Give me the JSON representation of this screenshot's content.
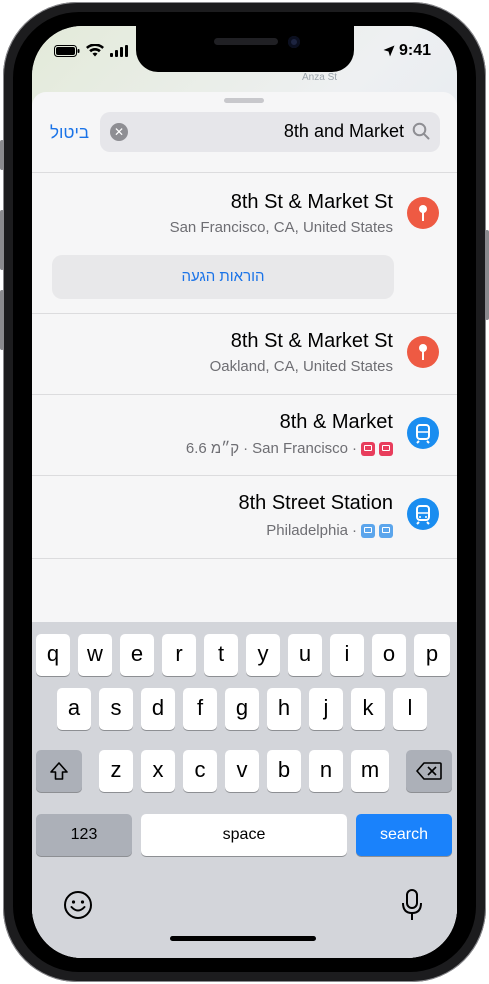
{
  "status_bar": {
    "time": "9:41"
  },
  "map": {
    "road_label": "Anza St"
  },
  "search": {
    "cancel_label": "ביטול",
    "query": "8th and Market"
  },
  "results": [
    {
      "title": "8th St & Market St",
      "subtitle": "San Francisco, CA, United States",
      "icon": "pin-icon",
      "directions_label": "הוראות הגעה"
    },
    {
      "title": "8th St & Market St",
      "subtitle": "Oakland, CA, United States",
      "icon": "pin-icon"
    },
    {
      "title": "8th & Market",
      "subtitle_distance": "6.6 ק״מ",
      "subtitle_city": "San Francisco",
      "icon": "tram-icon"
    },
    {
      "title": "8th Street Station",
      "subtitle_city": "Philadelphia",
      "icon": "train-icon"
    }
  ],
  "keyboard": {
    "row1": [
      "q",
      "w",
      "e",
      "r",
      "t",
      "y",
      "u",
      "i",
      "o",
      "p"
    ],
    "row2": [
      "a",
      "s",
      "d",
      "f",
      "g",
      "h",
      "j",
      "k",
      "l"
    ],
    "row3": [
      "z",
      "x",
      "c",
      "v",
      "b",
      "n",
      "m"
    ],
    "numbers_label": "123",
    "space_label": "space",
    "search_label": "search"
  },
  "colors": {
    "accent": "#1a73e8",
    "pin": "#ee5a43",
    "transit": "#1a8df0",
    "search_key": "#1a82fb"
  }
}
